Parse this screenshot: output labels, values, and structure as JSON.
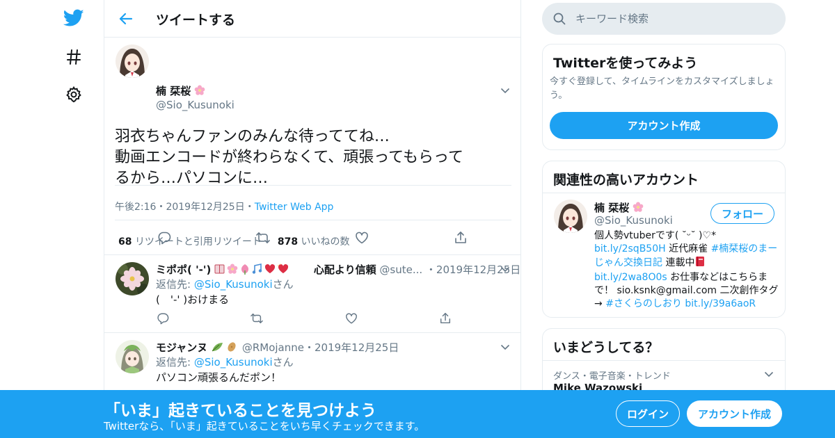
{
  "header": {
    "title": "ツイートする"
  },
  "tweet": {
    "name": "楠 栞桜",
    "handle": "@Sio_Kusunoki",
    "text_lines": [
      "羽衣ちゃんファンのみんな待っててね…",
      "動画エンコードが終わらなくて、頑張ってもらって",
      "るから…パソコンに…"
    ],
    "time": "午後2:16",
    "date": "2019年12月25日",
    "source": "Twitter Web App",
    "retweets_count": "68",
    "retweets_label": "リツイートと引用リツイート",
    "likes_count": "878",
    "likes_label": "いいねの数"
  },
  "replies": [
    {
      "name": "ミポポ( '-')",
      "name_suffix": "心配より信頼",
      "handle": "@sute...",
      "date": "・2019年12月25日",
      "reply_prefix": "返信先: ",
      "reply_to": "@Sio_Kusunoki",
      "reply_suffix": "さん",
      "text": "(　'-' )おけまる"
    },
    {
      "name": "モジャンヌ",
      "handle": "@RMojanne",
      "date": "・2019年12月25日",
      "reply_prefix": "返信先: ",
      "reply_to": "@Sio_Kusunoki",
      "reply_suffix": "さん",
      "text": "パソコン頑張るんだポン！"
    }
  ],
  "search": {
    "placeholder": "キーワード検索"
  },
  "signup_card": {
    "title": "Twitterを使ってみよう",
    "desc": "今すぐ登録して、タイムラインをカスタマイズしましょう。",
    "button": "アカウント作成"
  },
  "related_card": {
    "title": "関連性の高いアカウント",
    "name": "楠 栞桜",
    "handle": "@Sio_Kusunoki",
    "follow_button": "フォロー",
    "bio": {
      "line1": "個人勢vtuberです( ˘ᵕ˘ )♡*",
      "link1": "bit.ly/2sqB50H",
      "text2": " 近代麻雀 ",
      "hashtag1": "#楠栞桜のまーじゃん交換日記",
      "text3": " 連載中",
      "link2": "bit.ly/2wa8O0s",
      "text4": " お仕事などはこちらまで！ sio.ksnk@gmail.com 二次創作タグ → ",
      "hashtag2": "#さくらのしおり",
      "link3": "bit.ly/39a6aoR"
    }
  },
  "trends_card": {
    "title": "いまどうしてる？",
    "category": "ダンス・電子音楽・トレンド",
    "topic": "Mike Wazowski"
  },
  "banner": {
    "title": "「いま」起きていることを見つけよう",
    "subtitle": "Twitterなら、「いま」起きていることをいち早くチェックできます。",
    "login": "ログイン",
    "signup": "アカウント作成"
  },
  "colors": {
    "brand": "#1da1f2",
    "text_secondary": "#657786",
    "border": "#e6ecf0"
  }
}
